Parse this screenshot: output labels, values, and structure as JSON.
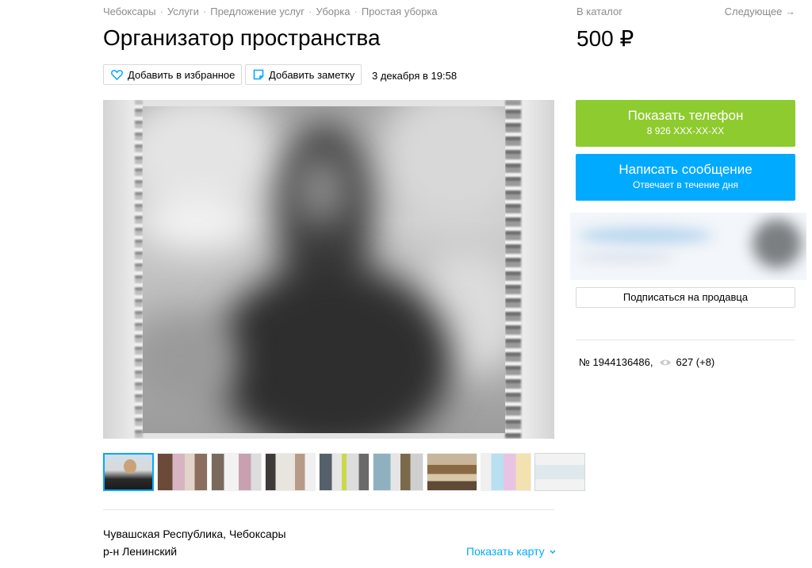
{
  "breadcrumbs": [
    "Чебоксары",
    "Услуги",
    "Предложение услуг",
    "Уборка",
    "Простая уборка"
  ],
  "nav": {
    "catalog": "В каталог",
    "next": "Следующее →"
  },
  "title": "Организатор пространства",
  "price": "500 ₽",
  "actions": {
    "favorite": "Добавить в избранное",
    "note": "Добавить заметку"
  },
  "date": "3 декабря в 19:58",
  "contact": {
    "phone_label": "Показать телефон",
    "phone_number": "8 926 XXX-XX-XX",
    "message_label": "Написать сообщение",
    "message_sub": "Отвечает в течение дня"
  },
  "seller": {
    "subscribe_label": "Подписаться на продавца"
  },
  "ad": {
    "number": "№ 1944136486,",
    "views": "627 (+8)"
  },
  "location": {
    "line1": "Чувашская Республика, Чебоксары",
    "line2": "р-н Ленинский",
    "map_link": "Показать карту"
  },
  "colors": {
    "accent": "#00aaff",
    "phone_button": "#8ecb2e",
    "muted_text": "#8c8c8c"
  },
  "icons": {
    "favorite": "heart-icon",
    "note": "note-icon",
    "views": "eye-icon",
    "map": "chevron-down-icon"
  }
}
